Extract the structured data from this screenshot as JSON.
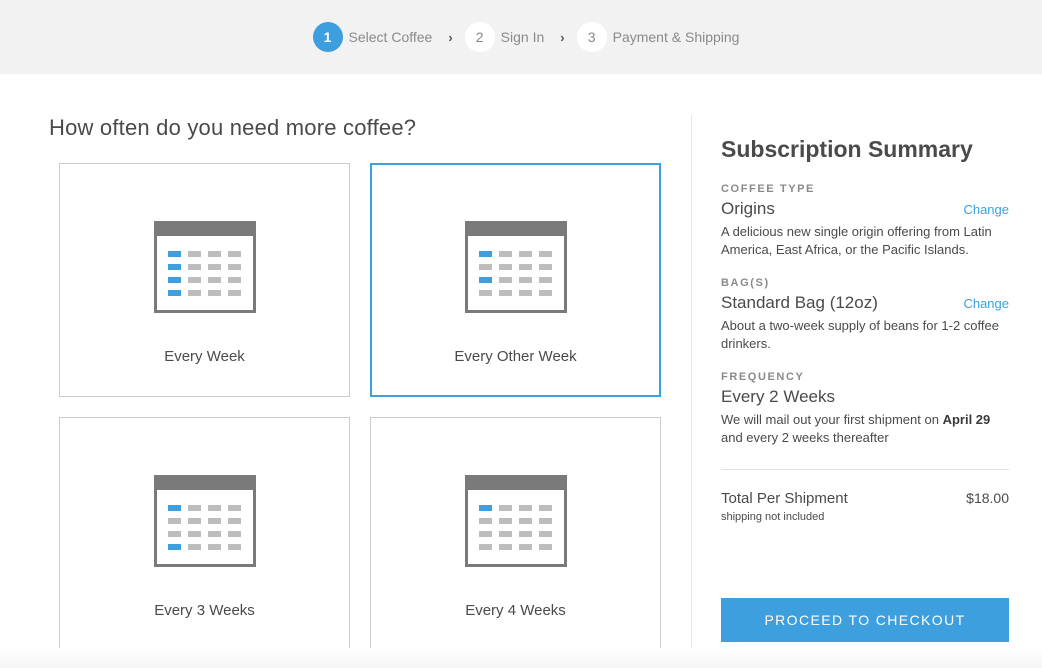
{
  "stepper": {
    "steps": [
      {
        "number": "1",
        "label": "Select Coffee",
        "active": true
      },
      {
        "number": "2",
        "label": "Sign In",
        "active": false
      },
      {
        "number": "3",
        "label": "Payment & Shipping",
        "active": false
      }
    ],
    "separator_icon": "chevron-right-icon"
  },
  "frequency": {
    "question": "How often do you need more coffee?",
    "options": [
      {
        "label": "Every Week",
        "selected": false,
        "icon": "calendar-icon",
        "highlighted_rows": [
          1,
          2,
          3,
          4
        ]
      },
      {
        "label": "Every Other Week",
        "selected": true,
        "icon": "calendar-icon",
        "highlighted_rows": [
          1,
          3
        ]
      },
      {
        "label": "Every 3 Weeks",
        "selected": false,
        "icon": "calendar-icon",
        "highlighted_rows": [
          1,
          4
        ]
      },
      {
        "label": "Every 4 Weeks",
        "selected": false,
        "icon": "calendar-icon",
        "highlighted_rows": [
          1
        ]
      }
    ]
  },
  "summary": {
    "title": "Subscription Summary",
    "coffee_type": {
      "label": "COFFEE TYPE",
      "value": "Origins",
      "change": "Change",
      "description": "A delicious new single origin offering from Latin America, East Africa, or the Pacific Islands."
    },
    "bags": {
      "label": "BAG(S)",
      "value": "Standard Bag (12oz)",
      "change": "Change",
      "description": "About a two-week supply of beans for 1-2 coffee drinkers."
    },
    "frequency": {
      "label": "FREQUENCY",
      "value": "Every 2 Weeks",
      "desc_prefix": "We will mail out your first shipment on ",
      "desc_date": "April 29",
      "desc_suffix": " and every 2 weeks thereafter"
    },
    "total_label": "Total Per Shipment",
    "total_price": "$18.00",
    "shipping_note": "shipping not included",
    "checkout_label": "PROCEED TO CHECKOUT"
  },
  "colors": {
    "accent": "#3d9fdd",
    "text": "#4a4a4a",
    "muted": "#8a8a8a",
    "header_bg": "#f2f2f2"
  }
}
